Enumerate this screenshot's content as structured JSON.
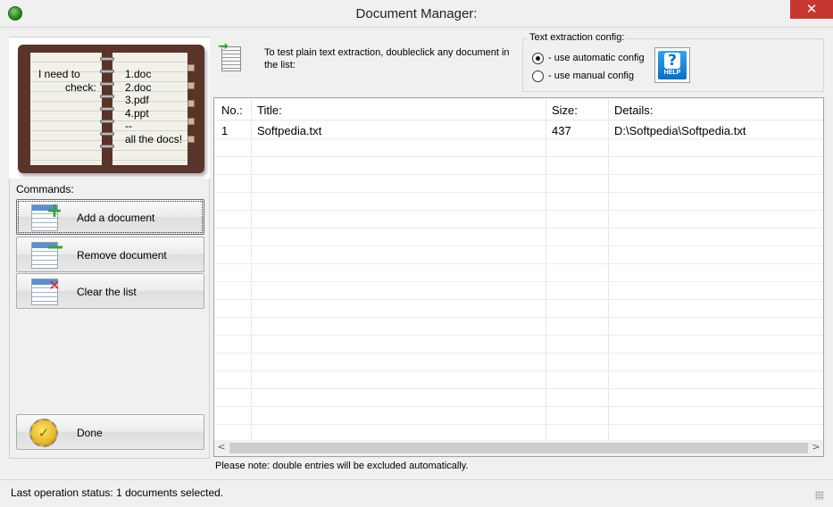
{
  "window": {
    "title": "Document Manager:",
    "close_glyph": "✕"
  },
  "notebook": {
    "left_line1": "I need to",
    "left_line2": "check:",
    "right_lines": [
      "1.doc",
      "2.doc",
      "3.pdf",
      "4.ppt",
      "--",
      "all the docs!"
    ]
  },
  "commands": {
    "label": "Commands:",
    "add": "Add a document",
    "remove": "Remove document",
    "clear": "Clear the list",
    "done": "Done"
  },
  "hint": {
    "text": "To test plain text extraction, doubleclick any document in the list:"
  },
  "config": {
    "title": "Text extraction config:",
    "auto_label": "- use automatic config",
    "manual_label": "- use manual config",
    "selected": "auto",
    "help_label": "HELP",
    "help_glyph": "?"
  },
  "table": {
    "columns": [
      "No.:",
      "Title:",
      "Size:",
      "Details:"
    ],
    "rows": [
      {
        "no": "1",
        "title": "Softpedia.txt",
        "size": "437",
        "details": "D:\\Softpedia\\Softpedia.txt"
      }
    ],
    "scroll_left": "<",
    "scroll_right": ">"
  },
  "note": "Please note: double entries will be excluded automatically.",
  "status": {
    "text": "Last operation status:  1 documents selected."
  },
  "icons": {
    "app": "app-globe-icon",
    "add": "add-document-icon",
    "remove": "remove-document-icon",
    "clear": "clear-list-icon",
    "done": "done-checkmark-icon",
    "hint": "document-arrow-icon",
    "help": "help-icon"
  },
  "colors": {
    "close": "#c7372f",
    "help": "#0b6fc2",
    "add": "#2ea82e",
    "clear": "#d22222"
  }
}
